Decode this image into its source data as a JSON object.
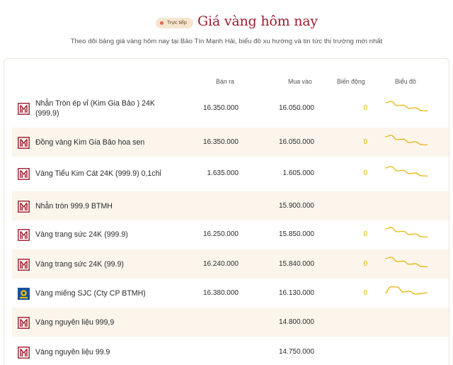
{
  "header": {
    "live_label": "Trực tiếp",
    "title": "Giá vàng hôm nay",
    "subtitle": "Theo dõi bảng giá vàng hôm nay tại Bảo Tín Mạnh Hải, biểu đồ xu hướng và tin tức thị trường mới nhất"
  },
  "table": {
    "columns": {
      "sell": "Bán ra",
      "buy": "Mua vào",
      "change": "Biến động",
      "chart": "Biểu đồ"
    },
    "rows": [
      {
        "name": "Nhẫn Tròn ép vỉ (Kim Gia Bảo ) 24K (999.9)",
        "sell": "16.350.000",
        "buy": "16.050.000",
        "change": "0",
        "logo": "btmh-logo",
        "sparkline": [
          0.15,
          0.05,
          0.35,
          0.32,
          0.55,
          0.5,
          0.7,
          0.72
        ]
      },
      {
        "name": "Đồng vàng Kim Gia Bảo hoa sen",
        "sell": "16.350.000",
        "buy": "16.050.000",
        "change": "0",
        "logo": "btmh-logo",
        "sparkline": [
          0.15,
          0.05,
          0.35,
          0.32,
          0.55,
          0.5,
          0.7,
          0.72
        ]
      },
      {
        "name": "Vàng Tiểu Kim Cát 24K (999.9) 0,1chỉ",
        "sell": "1.635.000",
        "buy": "1.605.000",
        "change": "0",
        "logo": "btmh-logo",
        "sparkline": [
          0.15,
          0.05,
          0.35,
          0.32,
          0.55,
          0.5,
          0.7,
          0.72
        ]
      },
      {
        "name": "Nhẫn tròn 999.9 BTMH",
        "sell": "",
        "buy": "15.900.000",
        "change": "",
        "logo": "btmh-logo",
        "sparkline": []
      },
      {
        "name": "Vàng trang sức 24K (999.9)",
        "sell": "16.250.000",
        "buy": "15.850.000",
        "change": "0",
        "logo": "btmh-logo",
        "sparkline": [
          0.15,
          0.05,
          0.35,
          0.32,
          0.55,
          0.5,
          0.7,
          0.72
        ]
      },
      {
        "name": "Vàng trang sức 24K (99.9)",
        "sell": "16.240.000",
        "buy": "15.840.000",
        "change": "0",
        "logo": "btmh-logo",
        "sparkline": [
          0.15,
          0.05,
          0.35,
          0.32,
          0.55,
          0.5,
          0.7,
          0.72
        ]
      },
      {
        "name": "Vàng miếng SJC (Cty CP BTMH)",
        "sell": "16.380.000",
        "buy": "16.130.000",
        "change": "0",
        "logo": "sjc-logo",
        "sparkline": [
          0.5,
          0.08,
          0.1,
          0.45,
          0.4,
          0.6,
          0.55,
          0.5
        ]
      },
      {
        "name": "Vàng nguyên liệu 999,9",
        "sell": "",
        "buy": "14.800.000",
        "change": "",
        "logo": "btmh-logo",
        "sparkline": []
      },
      {
        "name": "Vàng nguyên liệu 99.9",
        "sell": "",
        "buy": "14.750.000",
        "change": "",
        "logo": "btmh-logo",
        "sparkline": []
      }
    ]
  },
  "colors": {
    "brand_red": "#9b1b2e",
    "row_shade": "#fbf5ec",
    "sparkline": "#e8b000",
    "change_neutral": "#e8b000"
  }
}
